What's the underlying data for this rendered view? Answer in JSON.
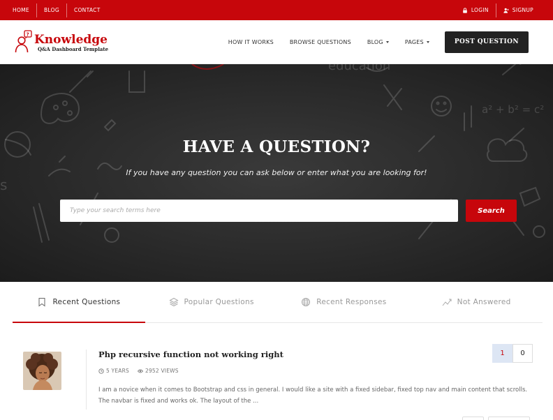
{
  "topbar": {
    "links": [
      "HOME",
      "BLOG",
      "CONTACT"
    ],
    "login": "LOGIN",
    "signup": "SIGNUP"
  },
  "header": {
    "logo_title": "Knowledge",
    "logo_subtitle": "Q&A Dashboard Template",
    "nav": [
      {
        "label": "HOW IT WORKS",
        "dropdown": false
      },
      {
        "label": "BROWSE QUESTIONS",
        "dropdown": false
      },
      {
        "label": "BLOG",
        "dropdown": true
      },
      {
        "label": "PAGES",
        "dropdown": true
      }
    ],
    "cta": "POST QUESTION"
  },
  "hero": {
    "title": "HAVE A QUESTION?",
    "subtitle": "If you have any question you can ask below or enter what you are looking for!",
    "search_placeholder": "Type your search terms here",
    "search_button": "Search"
  },
  "tabs": [
    {
      "label": "Recent Questions",
      "icon": "bookmark-icon",
      "active": true
    },
    {
      "label": "Popular Questions",
      "icon": "layers-icon",
      "active": false
    },
    {
      "label": "Recent Responses",
      "icon": "globe-icon",
      "active": false
    },
    {
      "label": "Not Answered",
      "icon": "trend-icon",
      "active": false
    }
  ],
  "question": {
    "title": "Php recursive function not working right",
    "age": "5 YEARS",
    "views": "2952 VIEWS",
    "excerpt": "I am a novice when it comes to Bootstrap and css in general. I would like a site with a fixed sidebar, fixed top nav and main content that scrolls. The navbar is fixed and works ok. The layout of the ...",
    "votes_up": "1",
    "votes_down": "0"
  },
  "colors": {
    "brand": "#c7060b",
    "dark": "#222222"
  }
}
